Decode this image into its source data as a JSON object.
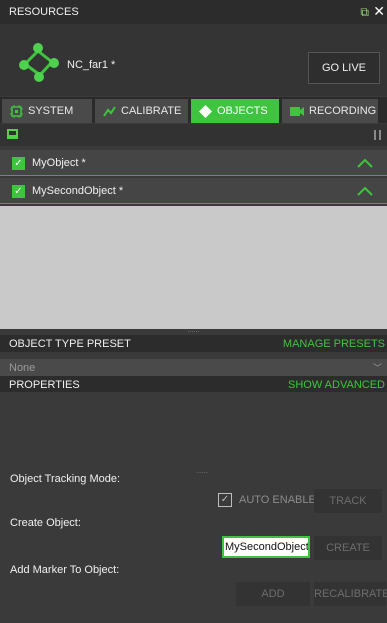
{
  "window": {
    "title": "RESOURCES"
  },
  "header": {
    "project_name": "NC_far1 *",
    "go_live_label": "GO LIVE"
  },
  "tabs": [
    {
      "label": "SYSTEM",
      "active": false
    },
    {
      "label": "CALIBRATE",
      "active": false
    },
    {
      "label": "OBJECTS",
      "active": true
    },
    {
      "label": "RECORDING",
      "active": false
    }
  ],
  "objects": [
    {
      "name": "MyObject *",
      "checked": true
    },
    {
      "name": "MySecondObject *",
      "checked": true
    }
  ],
  "preset": {
    "label": "OBJECT TYPE PRESET",
    "manage_label": "MANAGE PRESETS",
    "selected": "None"
  },
  "properties": {
    "label": "PROPERTIES",
    "advanced_label": "SHOW ADVANCED"
  },
  "form": {
    "tracking_label": "Object Tracking Mode:",
    "auto_enable_label": "AUTO ENABLE",
    "auto_enable_checked": true,
    "track_label": "TRACK",
    "create_label": "Create Object:",
    "object_name_value": "MySecondObject",
    "create_button": "CREATE",
    "marker_label": "Add Marker To Object:",
    "add_button": "ADD",
    "recalibrate_button": "RECALIBRATE"
  },
  "colors": {
    "accent": "#3ec43e",
    "panel": "#3a3a3a",
    "list_bg": "#c9c9c9"
  }
}
